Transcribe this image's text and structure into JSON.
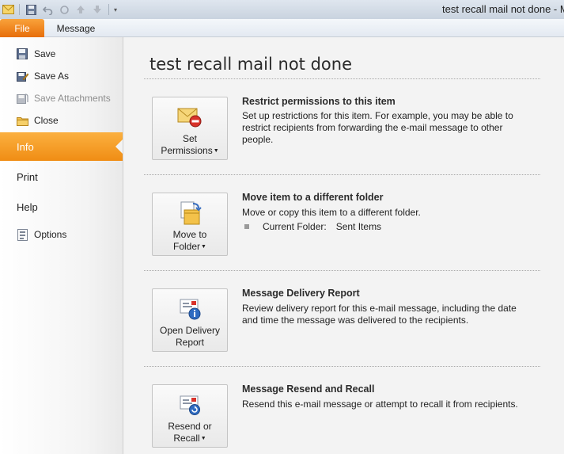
{
  "window": {
    "title": "test recall mail not done - M"
  },
  "ribbon": {
    "tabs": [
      {
        "label": "File"
      },
      {
        "label": "Message"
      }
    ]
  },
  "nav": {
    "commands": [
      {
        "label": "Save",
        "icon": "save-icon"
      },
      {
        "label": "Save As",
        "icon": "save-as-icon"
      },
      {
        "label": "Save Attachments",
        "icon": "save-attachments-icon",
        "disabled": true
      },
      {
        "label": "Close",
        "icon": "folder-close-icon"
      }
    ],
    "tabs": [
      {
        "label": "Info",
        "active": true
      },
      {
        "label": "Print"
      },
      {
        "label": "Help"
      }
    ],
    "options": {
      "label": "Options",
      "icon": "options-icon"
    }
  },
  "main": {
    "title": "test recall mail not done",
    "sections": [
      {
        "button_line1": "Set",
        "button_line2": "Permissions",
        "icon": "envelope-restrict-icon",
        "heading": "Restrict permissions to this item",
        "description": "Set up restrictions for this item. For example, you may be able to restrict recipients from forwarding the e-mail message to other people."
      },
      {
        "button_line1": "Move to",
        "button_line2": "Folder",
        "icon": "move-to-folder-icon",
        "heading": "Move item to a different folder",
        "description": "Move or copy this item to a different folder.",
        "folder_label": "Current Folder:",
        "folder_value": "Sent Items"
      },
      {
        "button_line1": "Open Delivery",
        "button_line2": "Report",
        "icon": "delivery-report-icon",
        "heading": "Message Delivery Report",
        "description": "Review delivery report for this e-mail message, including the date and time the message was delivered to the recipients."
      },
      {
        "button_line1": "Resend or",
        "button_line2": "Recall",
        "icon": "resend-recall-icon",
        "heading": "Message Resend and Recall",
        "description": "Resend this e-mail message or attempt to recall it from recipients."
      }
    ]
  },
  "colors": {
    "accent": "#f08d14",
    "file_tab": "#e76e0b"
  }
}
